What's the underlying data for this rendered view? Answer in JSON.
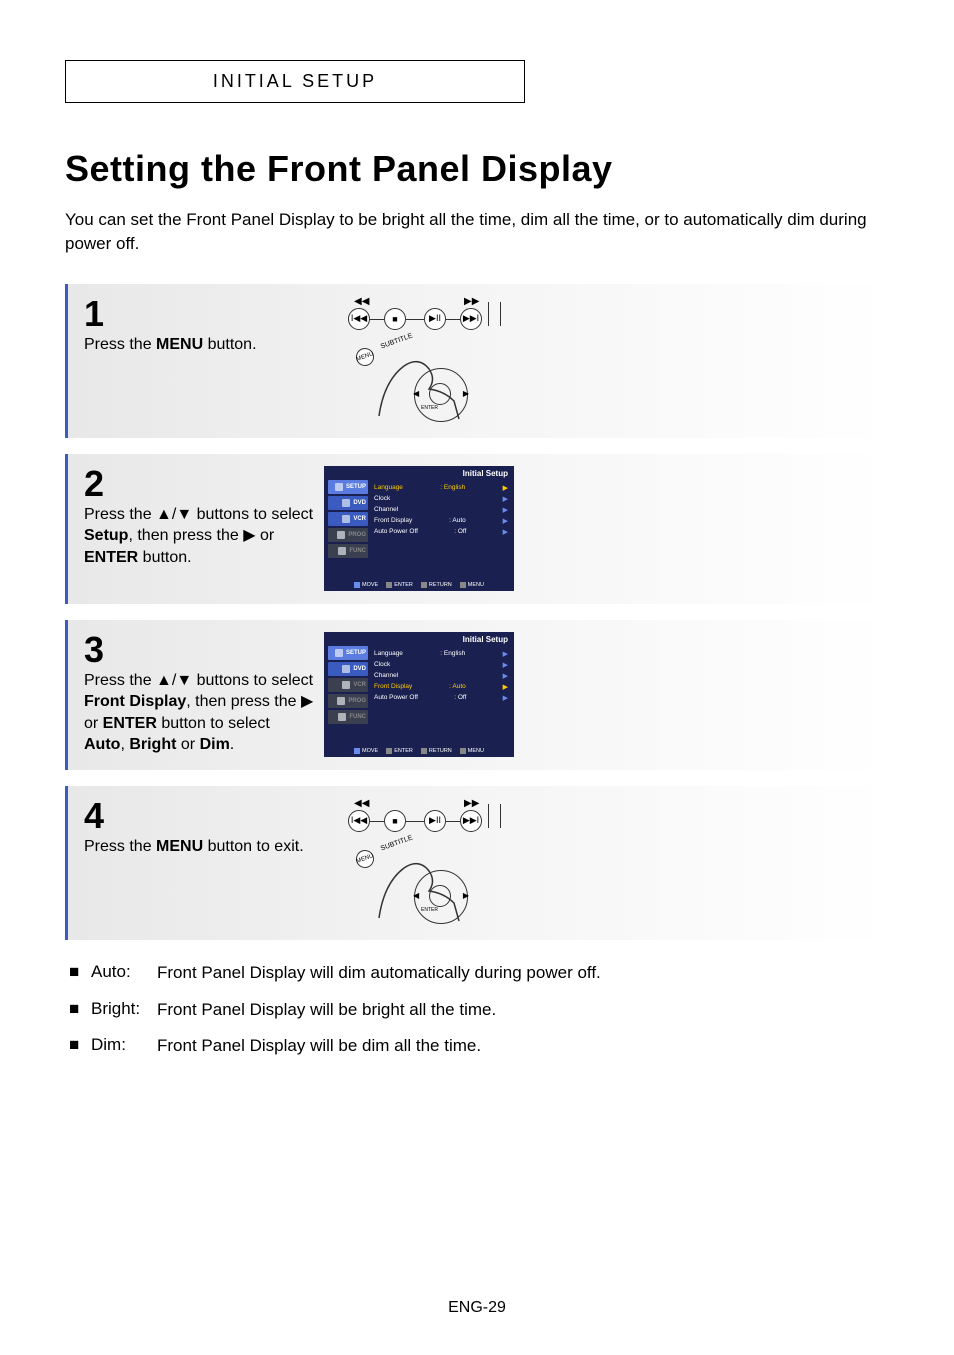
{
  "header": {
    "section": "INITIAL SETUP"
  },
  "title": "Setting the Front Panel Display",
  "intro": "You can set the Front Panel Display to be bright all the time, dim all the time, or to automatically dim during power off.",
  "steps": {
    "s1": {
      "num": "1",
      "pre": "Press the ",
      "bold": "MENU",
      "post": " button."
    },
    "s2": {
      "num": "2",
      "t1": "Press the ▲/▼ buttons to select ",
      "b1": "Setup",
      "t2": ", then press the ▶ or ",
      "b2": "ENTER",
      "t3": " button."
    },
    "s3": {
      "num": "3",
      "t1": "Press the ▲/▼ buttons to select ",
      "b1": "Front Display",
      "t2": ", then press the ▶ or ",
      "b2": "ENTER",
      "t3": " button to select ",
      "b3": "Auto",
      "t4": ", ",
      "b4": "Bright",
      "t5": " or ",
      "b5": "Dim",
      "t6": "."
    },
    "s4": {
      "num": "4",
      "pre": "Press the ",
      "bold": "MENU",
      "post": " button to exit."
    }
  },
  "menu": {
    "title": "Initial Setup",
    "tabs": {
      "setup": "SETUP",
      "dvd": "DVD",
      "vcr": "VCR",
      "prog": "PROG",
      "func": "FUNC"
    },
    "items": {
      "language": "Language",
      "language_val": ": English",
      "clock": "Clock",
      "channel": "Channel",
      "front": "Front Display",
      "front_val": ": Auto",
      "auto": "Auto Power Off",
      "auto_val": ": Off"
    },
    "footer": {
      "move": "MOVE",
      "enter": "ENTER",
      "return": "RETURN",
      "menu": "MENU"
    }
  },
  "remote": {
    "subtitle": "SUBTITLE",
    "menu": "MENU",
    "enter": "ENTER"
  },
  "bullets": {
    "b1": {
      "label": "Auto:",
      "desc": "Front Panel Display will dim automatically during power off."
    },
    "b2": {
      "label": "Bright:",
      "desc": "Front Panel Display will be bright all the time."
    },
    "b3": {
      "label": "Dim:",
      "desc": "Front Panel Display will be dim all the time."
    }
  },
  "page": "ENG-29"
}
